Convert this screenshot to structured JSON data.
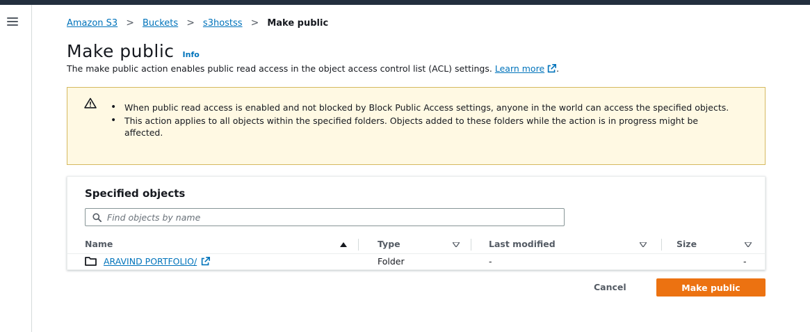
{
  "nav": {
    "menu_icon": "hamburger-icon"
  },
  "breadcrumb": {
    "items": [
      "Amazon S3",
      "Buckets",
      "s3hostss"
    ],
    "current": "Make public",
    "separator": ">"
  },
  "page": {
    "title": "Make public",
    "info_label": "Info",
    "description": "The make public action enables public read access in the object access control list (ACL) settings.",
    "learn_more": "Learn more"
  },
  "warning": {
    "icon": "warning-icon",
    "items": [
      "When public read access is enabled and not blocked by Block Public Access settings, anyone in the world can access the specified objects.",
      "This action applies to all objects within the specified folders. Objects added to these folders while the action is in progress might be affected."
    ]
  },
  "objects": {
    "heading": "Specified objects",
    "search_placeholder": "Find objects by name",
    "columns": [
      "Name",
      "Type",
      "Last modified",
      "Size"
    ],
    "rows": [
      {
        "name": "ARAVIND PORTFOLIO/",
        "type": "Folder",
        "last_modified": "-",
        "size": "-"
      }
    ]
  },
  "actions": {
    "cancel": "Cancel",
    "primary": "Make public"
  },
  "colors": {
    "accent": "#ec7211",
    "link": "#0073bb",
    "warning_bg": "#fff9e3",
    "topbar": "#232f3e"
  }
}
